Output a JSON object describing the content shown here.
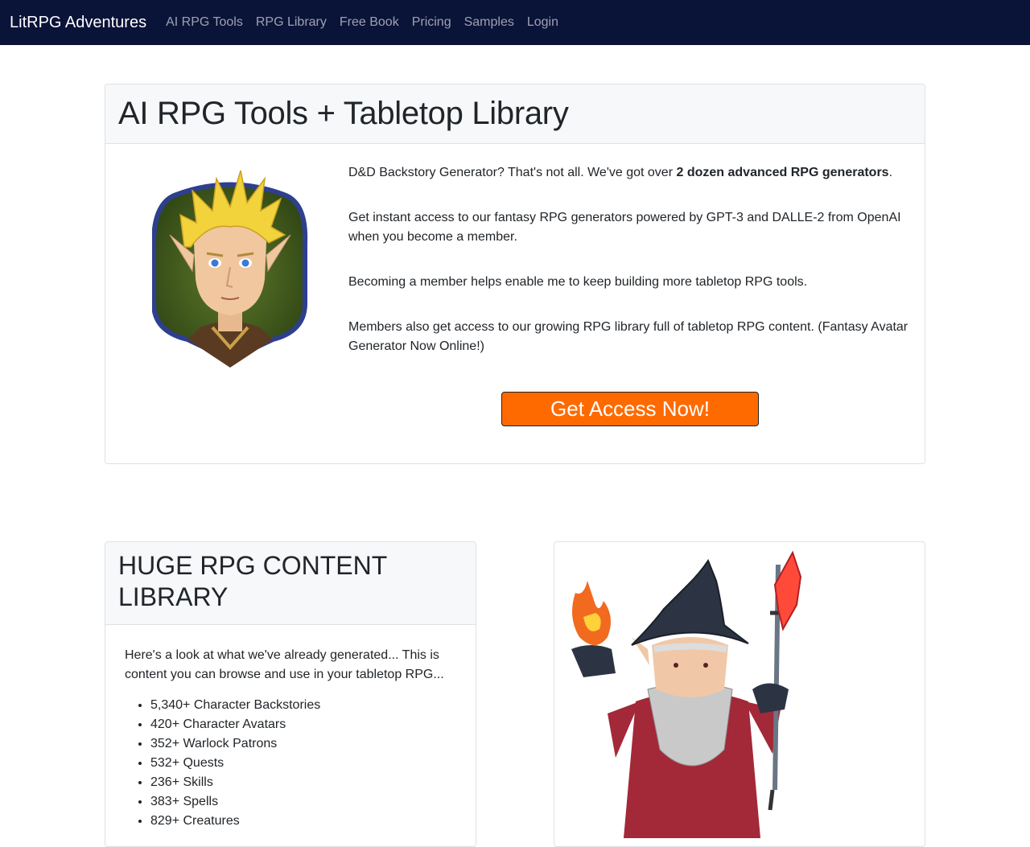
{
  "nav": {
    "brand": "LitRPG Adventures",
    "links": [
      "AI RPG Tools",
      "RPG Library",
      "Free Book",
      "Pricing",
      "Samples",
      "Login"
    ]
  },
  "hero": {
    "title": "AI RPG Tools + Tabletop Library",
    "p1_before": "D&D Backstory Generator? That's not all. We've got over ",
    "p1_bold": "2 dozen advanced RPG generators",
    "p1_after": ".",
    "p2": "Get instant access to our fantasy RPG generators powered by GPT-3 and DALLE-2 from OpenAI when you become a member.",
    "p3": "Becoming a member helps enable me to keep building more tabletop RPG tools.",
    "p4": "Members also get access to our growing RPG library full of tabletop RPG content. (Fantasy Avatar Generator Now Online!)",
    "cta_label": "Get Access Now!"
  },
  "library": {
    "title": "HUGE RPG CONTENT LIBRARY",
    "intro": "Here's a look at what we've already generated... This is content you can browse and use in your tabletop RPG...",
    "items": [
      "5,340+ Character Backstories",
      "420+ Character Avatars",
      "352+ Warlock Patrons",
      "532+ Quests",
      "236+ Skills",
      "383+ Spells",
      "829+ Creatures"
    ]
  },
  "colors": {
    "nav_bg": "#0a1338",
    "cta_bg": "#ff6a00"
  },
  "icons": {
    "portrait": "elf-portrait-image",
    "wizard": "wizard-image"
  }
}
